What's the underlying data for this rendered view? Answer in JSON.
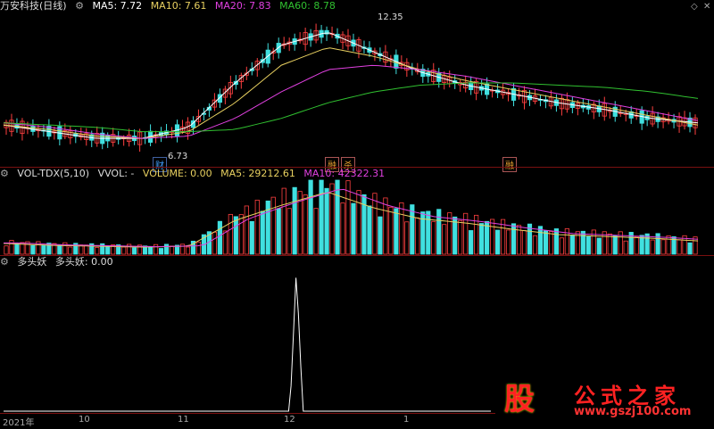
{
  "main_panel": {
    "title": "万安科技(日线)",
    "ma5": "MA5: 7.72",
    "ma10": "MA10: 7.61",
    "ma20": "MA20: 7.83",
    "ma60": "MA60: 8.78",
    "high_label": "12.35",
    "low_label": "6.73",
    "tags": [
      "财",
      "融",
      "杀",
      "融"
    ],
    "colors": {
      "ma5": "#ffffff",
      "ma10": "#e8d060",
      "ma20": "#e040e0",
      "ma60": "#30c030",
      "up": "#ff4040",
      "down": "#40e0e0"
    }
  },
  "vol_panel": {
    "title": "VOL-TDX(5,10)",
    "vvol": "VVOL: -",
    "volume": "VOLUME: 0.00",
    "ma5": "MA5: 29212.61",
    "ma10": "MA10: 42322.31"
  },
  "ind_panel": {
    "title": "多头妖",
    "value": "多头妖: 0.00"
  },
  "xaxis": [
    "2021年",
    "10",
    "11",
    "12",
    "1"
  ],
  "logo": {
    "char": "股",
    "name": "公式之家",
    "url": "www.gszj100.com"
  },
  "chart_data": [
    {
      "type": "line",
      "title": "万安科技(日线)",
      "series": [
        {
          "name": "MA5",
          "values": [
            7.6,
            7.3,
            7.0,
            7.0,
            7.5,
            9.5,
            11.2,
            11.8,
            10.9,
            10.0,
            9.4,
            9.0,
            8.6,
            8.3,
            7.9,
            7.7
          ]
        },
        {
          "name": "MA10",
          "values": [
            7.6,
            7.4,
            7.1,
            7.0,
            7.3,
            8.6,
            10.3,
            11.1,
            10.7,
            10.1,
            9.6,
            9.2,
            8.8,
            8.4,
            8.0,
            7.6
          ]
        },
        {
          "name": "MA20",
          "values": [
            7.7,
            7.5,
            7.2,
            7.0,
            7.1,
            7.9,
            9.1,
            10.1,
            10.3,
            10.1,
            9.8,
            9.4,
            9.0,
            8.6,
            8.2,
            7.8
          ]
        },
        {
          "name": "MA60",
          "values": [
            7.7,
            7.6,
            7.5,
            7.3,
            7.3,
            7.4,
            7.9,
            8.6,
            9.1,
            9.4,
            9.5,
            9.5,
            9.4,
            9.3,
            9.1,
            8.8
          ]
        }
      ],
      "annotations": [
        "12.35",
        "6.73"
      ]
    },
    {
      "type": "bar",
      "title": "VOL-TDX(5,10)",
      "values": [
        12,
        10,
        9,
        8,
        9,
        38,
        55,
        70,
        52,
        40,
        35,
        28,
        22,
        20,
        18,
        15
      ]
    },
    {
      "type": "line",
      "title": "多头妖",
      "values": [
        0,
        0,
        0,
        0,
        0,
        0,
        0,
        1,
        0,
        0,
        0,
        0,
        0,
        0,
        0,
        0
      ]
    }
  ]
}
